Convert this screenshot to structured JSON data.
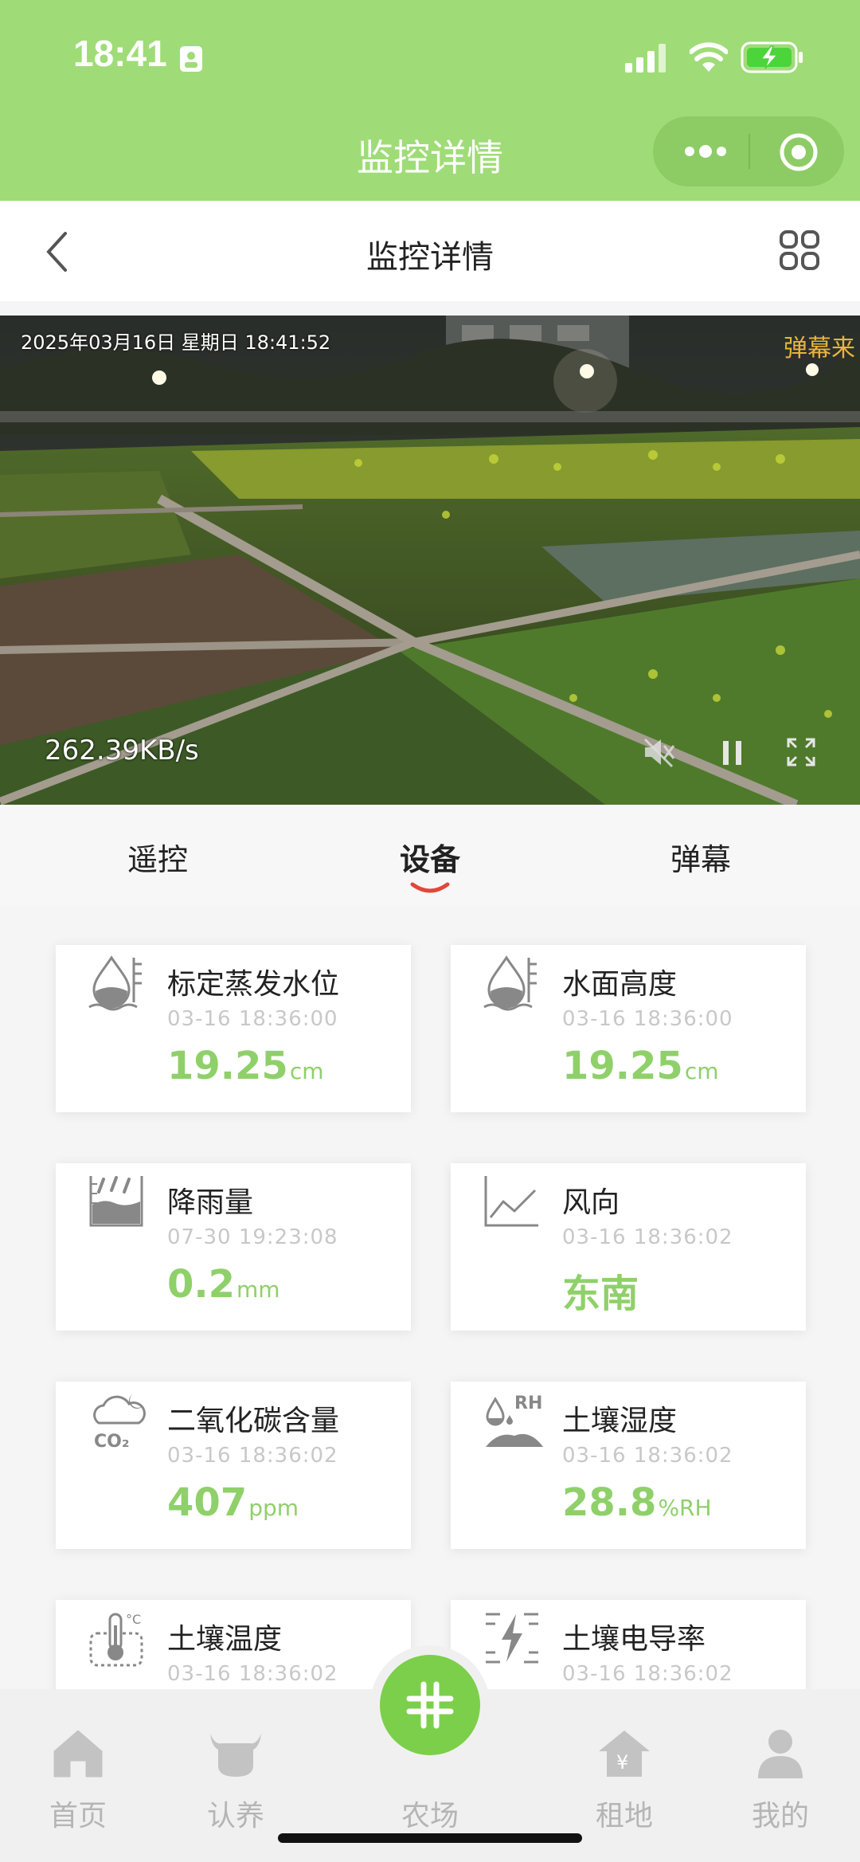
{
  "status_bar": {
    "time": "18:41",
    "battery_state": "charging",
    "icons": [
      "id-card-icon",
      "signal-icon",
      "wifi-icon",
      "battery-icon"
    ]
  },
  "app_header": {
    "title": "监控详情",
    "capsule_icons": [
      "more-icon",
      "close-target-icon"
    ]
  },
  "nav": {
    "title": "监控详情",
    "icons": [
      "back-icon",
      "grid-icon"
    ]
  },
  "video": {
    "osd_timestamp": "2025年03月16日 星期日 18:41:52",
    "danmu_text": "弹幕来",
    "speed": "262.39KB/s",
    "controls": [
      "mute-icon",
      "pause-icon",
      "fullscreen-icon"
    ]
  },
  "tabs": {
    "items": [
      "遥控",
      "设备",
      "弹幕"
    ],
    "active": "设备"
  },
  "colors": {
    "header_green": "#9fdc77",
    "value_green": "#8fd06a",
    "fab_green": "#7ccf4a",
    "tab_underline": "#e0483a"
  },
  "cards": [
    {
      "name": "标定蒸发水位",
      "time": "03-16 18:36:00",
      "value": "19.25",
      "unit": "cm",
      "icon": "water-level-icon"
    },
    {
      "name": "水面高度",
      "time": "03-16 18:36:00",
      "value": "19.25",
      "unit": "cm",
      "icon": "water-level-icon"
    },
    {
      "name": "降雨量",
      "time": "07-30 19:23:08",
      "value": "0.2",
      "unit": "mm",
      "icon": "rainfall-icon"
    },
    {
      "name": "风向",
      "time": "03-16 18:36:02",
      "value": "东南",
      "unit": "",
      "icon": "line-chart-icon"
    },
    {
      "name": "二氧化碳含量",
      "time": "03-16 18:36:02",
      "value": "407",
      "unit": "ppm",
      "icon": "co2-cloud-icon"
    },
    {
      "name": "土壤湿度",
      "time": "03-16 18:36:02",
      "value": "28.8",
      "unit": "%RH",
      "icon": "soil-humidity-icon"
    },
    {
      "name": "土壤温度",
      "time": "03-16 18:36:02",
      "value": "",
      "unit": "",
      "icon": "soil-temperature-icon"
    },
    {
      "name": "土壤电导率",
      "time": "03-16 18:36:02",
      "value": "",
      "unit": "",
      "icon": "soil-conductivity-icon"
    }
  ],
  "co2_icon_text": "CO₂",
  "rh_icon_text": "RH",
  "tabbar": {
    "items": [
      {
        "label": "首页",
        "icon": "home-icon"
      },
      {
        "label": "认养",
        "icon": "cow-icon"
      },
      {
        "label": "农场",
        "icon": "farm-fab-icon"
      },
      {
        "label": "租地",
        "icon": "rent-land-icon"
      },
      {
        "label": "我的",
        "icon": "profile-icon"
      }
    ]
  }
}
